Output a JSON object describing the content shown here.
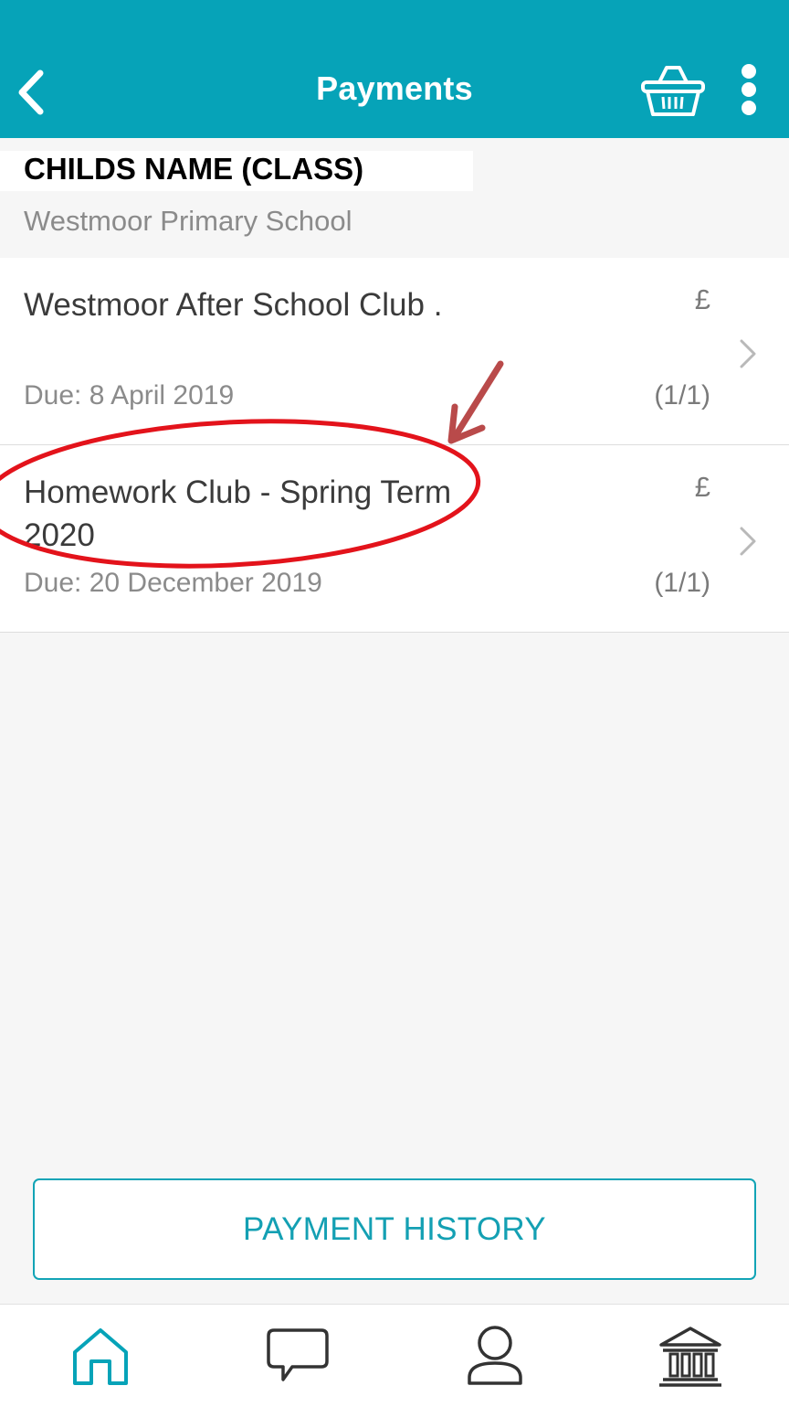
{
  "header": {
    "title": "Payments",
    "back_icon": "chevron-left-icon",
    "basket_icon": "basket-icon",
    "more_icon": "more-vertical-icon",
    "color": "#06a3b8"
  },
  "child": {
    "name_label": "CHILDS NAME (CLASS)",
    "school": "Westmoor Primary School"
  },
  "payments": [
    {
      "title": "Westmoor After School Club .",
      "due": "Due: 8 April 2019",
      "currency": "£",
      "count": "(1/1)"
    },
    {
      "title": "Homework Club - Spring Term 2020",
      "due": "Due: 20 December 2019",
      "currency": "£",
      "count": "(1/1)"
    }
  ],
  "annotation": {
    "color": "#e3131b",
    "arrow_color": "#b94a4a"
  },
  "actions": {
    "payment_history": "PAYMENT HISTORY"
  },
  "tabbar": {
    "items": [
      {
        "icon": "home-icon",
        "active": true
      },
      {
        "icon": "chat-icon",
        "active": false
      },
      {
        "icon": "user-icon",
        "active": false
      },
      {
        "icon": "bank-icon",
        "active": false
      }
    ],
    "active_color": "#06a3b8",
    "inactive_color": "#333333"
  }
}
